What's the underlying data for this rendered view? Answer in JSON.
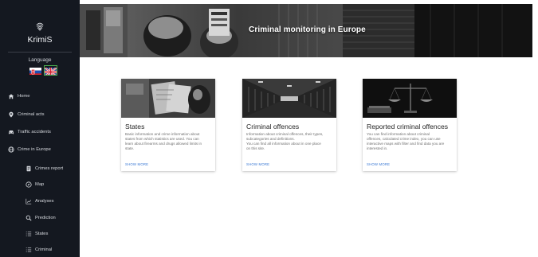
{
  "app": {
    "name": "KrimiS"
  },
  "language": {
    "label": "Language",
    "options": [
      "Slovak",
      "English"
    ]
  },
  "nav": {
    "items": [
      {
        "label": "Home",
        "icon": "home-icon"
      },
      {
        "label": "Criminal acts",
        "icon": "pin-icon"
      },
      {
        "label": "Traffic accidents",
        "icon": "car-icon"
      },
      {
        "label": "Crime in Europe",
        "icon": "globe-icon"
      }
    ],
    "subitems": [
      {
        "label": "Crimes report",
        "icon": "report-icon"
      },
      {
        "label": "Map",
        "icon": "compass-icon"
      },
      {
        "label": "Analyses",
        "icon": "chart-icon"
      },
      {
        "label": "Prediction",
        "icon": "search-icon"
      },
      {
        "label": "States",
        "icon": "list-icon"
      },
      {
        "label": "Criminal",
        "icon": "list-icon"
      }
    ]
  },
  "hero": {
    "title": "Criminal monitoring in Europe"
  },
  "cards": [
    {
      "title": "States",
      "lines": [
        "Basic information and crime information about",
        "states from which statistics are used. You can",
        "learn about firearms and drugs allowed limits in",
        "state."
      ],
      "action": "SHOW MORE"
    },
    {
      "title": "Criminal offences",
      "lines": [
        "Information about criminal offences, their types,",
        "subcategories and definitions.",
        "You can find all information about in one place",
        "on this site."
      ],
      "action": "SHOW MORE"
    },
    {
      "title": "Reported criminal offences",
      "lines": [
        "You can find information about criminal",
        "offences, calculated crime index, you can use",
        "interactive maps with filter and find data you are",
        "interested in."
      ],
      "action": "SHOW MORE"
    }
  ]
}
